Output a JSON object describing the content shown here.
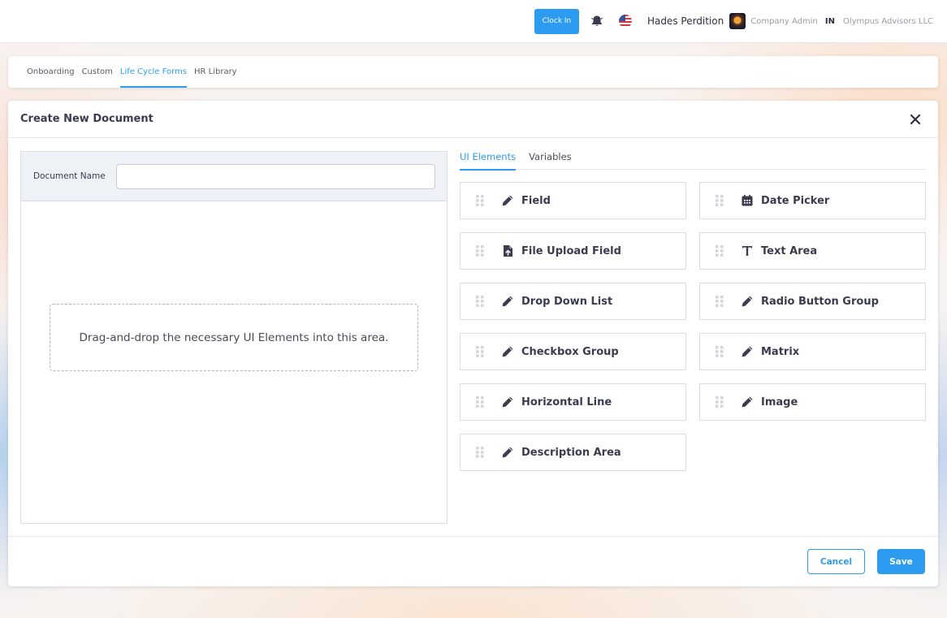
{
  "header": {
    "clock_in_label": "Clock In",
    "user_name": "Hades Perdition",
    "role": "Company Admin",
    "language": "IN",
    "company": "Olympus Advisors LLC",
    "accent_color": "#2d9bf0"
  },
  "tabs": [
    {
      "label": "Onboarding",
      "active": false
    },
    {
      "label": "Custom",
      "active": false
    },
    {
      "label": "Life Cycle Forms",
      "active": true
    },
    {
      "label": "HR Library",
      "active": false
    }
  ],
  "dialog": {
    "title": "Create New Document",
    "document_name_label": "Document Name",
    "document_name_value": "",
    "drop_zone_text": "Drag-and-drop the necessary UI Elements into this area.",
    "right_tabs": [
      {
        "label": "UI Elements",
        "active": true
      },
      {
        "label": "Variables",
        "active": false
      }
    ],
    "elements": [
      {
        "label": "Field",
        "icon": "pencil-icon"
      },
      {
        "label": "Date Picker",
        "icon": "calendar-icon"
      },
      {
        "label": "File Upload Field",
        "icon": "file-upload-icon"
      },
      {
        "label": "Text Area",
        "icon": "text-icon"
      },
      {
        "label": "Drop Down List",
        "icon": "pencil-icon"
      },
      {
        "label": "Radio Button Group",
        "icon": "pencil-icon"
      },
      {
        "label": "Checkbox Group",
        "icon": "pencil-icon"
      },
      {
        "label": "Matrix",
        "icon": "pencil-icon"
      },
      {
        "label": "Horizontal Line",
        "icon": "pencil-icon"
      },
      {
        "label": "Image",
        "icon": "pencil-icon"
      },
      {
        "label": "Description Area",
        "icon": "pencil-icon"
      }
    ],
    "cancel_label": "Cancel",
    "save_label": "Save"
  }
}
